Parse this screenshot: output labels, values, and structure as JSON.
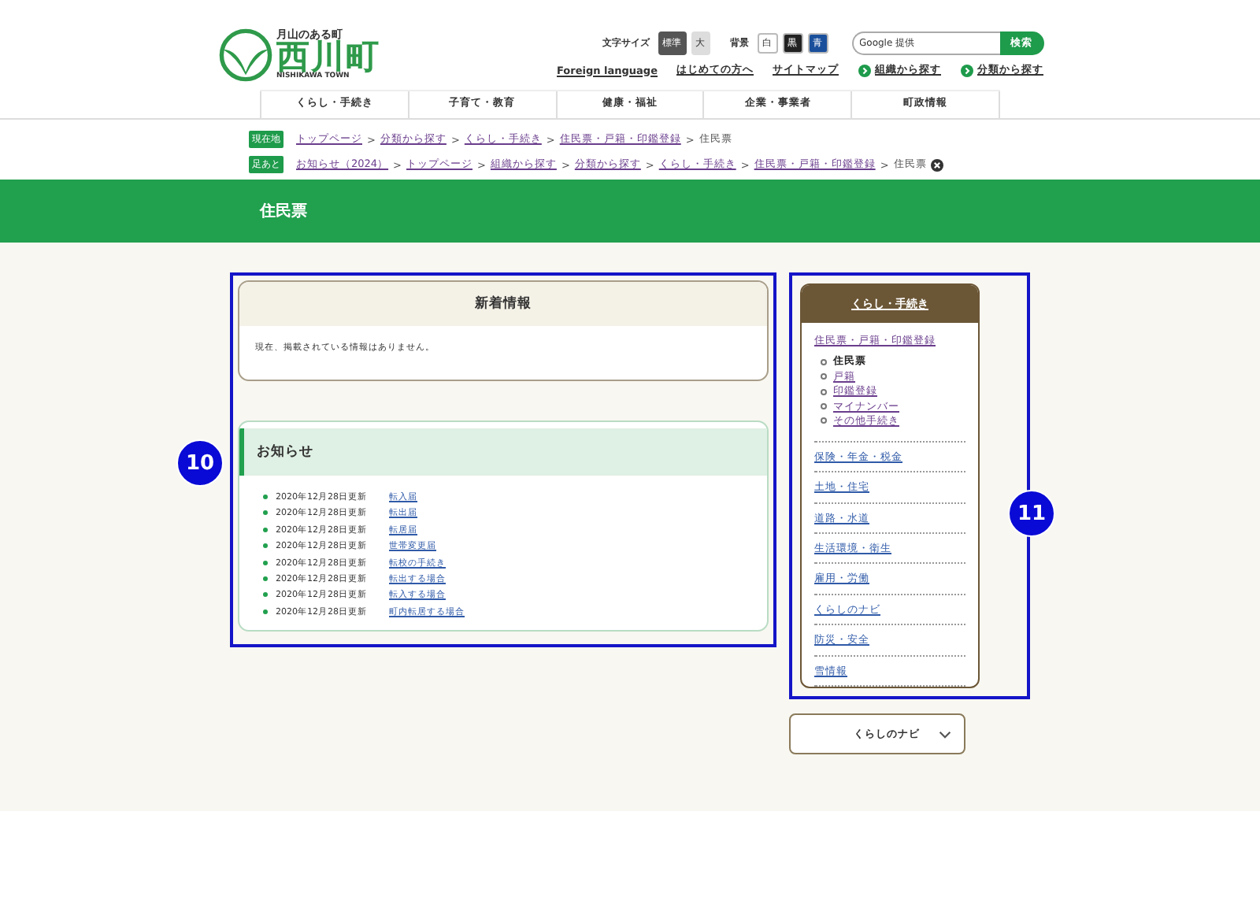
{
  "header": {
    "logo": {
      "tagline": "月山のある町",
      "name": "西川町",
      "subtitle": "NISHIKAWA TOWN"
    },
    "font_size": {
      "label": "文字サイズ",
      "options": [
        {
          "label": "標準",
          "selected": true
        },
        {
          "label": "大",
          "selected": false
        }
      ]
    },
    "background": {
      "label": "背景",
      "options": [
        {
          "label": "白",
          "kind": "white"
        },
        {
          "label": "黒",
          "kind": "black"
        },
        {
          "label": "青",
          "kind": "blue"
        }
      ]
    },
    "search": {
      "placeholder": "Google 提供",
      "button": "検索"
    },
    "links": [
      {
        "label": "Foreign language",
        "kind": "plain"
      },
      {
        "label": "はじめての方へ",
        "kind": "plain"
      },
      {
        "label": "サイトマップ",
        "kind": "plain"
      },
      {
        "label": "組織から探す",
        "kind": "arrow"
      },
      {
        "label": "分類から探す",
        "kind": "arrow"
      }
    ],
    "nav": [
      "くらし・手続き",
      "子育て・教育",
      "健康・福祉",
      "企業・事業者",
      "町政情報"
    ]
  },
  "breadcrumbs": [
    {
      "badge": "現在地",
      "separator": ">",
      "items": [
        "トップページ",
        "分類から探す",
        "くらし・手続き",
        "住民票・戸籍・印鑑登録"
      ],
      "current": "住民票",
      "removable": false
    },
    {
      "badge": "足あと",
      "separator": ">",
      "items": [
        "お知らせ（2024）",
        "トップページ",
        "組織から探す",
        "分類から探す",
        "くらし・手続き",
        "住民票・戸籍・印鑑登録"
      ],
      "current": "住民票",
      "removable": true
    }
  ],
  "page_title": "住民票",
  "new_info": {
    "title": "新着情報",
    "message": "現在、掲載されている情報はありません。"
  },
  "notices": {
    "title": "お知らせ",
    "items": [
      {
        "date": "2020年12月28日更新",
        "link": "転入届"
      },
      {
        "date": "2020年12月28日更新",
        "link": "転出届"
      },
      {
        "date": "2020年12月28日更新",
        "link": "転居届"
      },
      {
        "date": "2020年12月28日更新",
        "link": "世帯変更届"
      },
      {
        "date": "2020年12月28日更新",
        "link": "転校の手続き"
      },
      {
        "date": "2020年12月28日更新",
        "link": "転出する場合"
      },
      {
        "date": "2020年12月28日更新",
        "link": "転入する場合"
      },
      {
        "date": "2020年12月28日更新",
        "link": "町内転居する場合"
      }
    ]
  },
  "sidebar": {
    "title": "くらし・手続き",
    "group": "住民票・戸籍・印鑑登録",
    "children": [
      {
        "label": "住民票",
        "selected": true
      },
      {
        "label": "戸籍",
        "selected": false
      },
      {
        "label": "印鑑登録",
        "selected": false
      },
      {
        "label": "マイナンバー",
        "selected": false
      },
      {
        "label": "その他手続き",
        "selected": false
      }
    ],
    "items": [
      "保険・年金・税金",
      "土地・住宅",
      "道路・水道",
      "生活環境・衛生",
      "雇用・労働",
      "くらしのナビ",
      "防災・安全",
      "雪情報"
    ]
  },
  "navi_button": "くらしのナビ",
  "annotations": [
    "10",
    "11"
  ]
}
